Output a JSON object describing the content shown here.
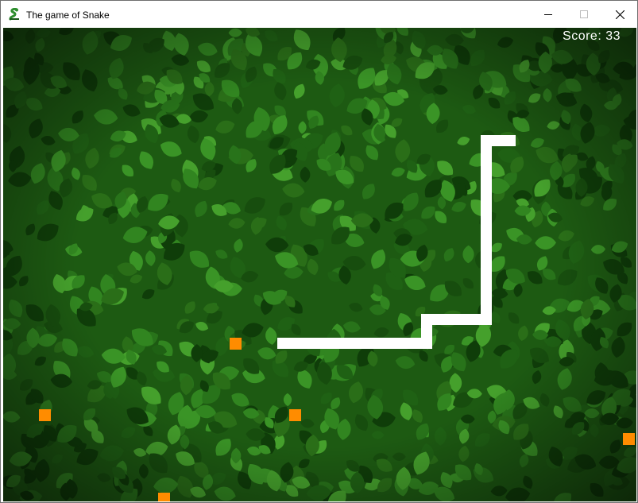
{
  "window": {
    "title": "The game of Snake",
    "app_icon": "snake-icon",
    "controls": [
      "minimize-icon",
      "maximize-icon",
      "close-icon"
    ]
  },
  "game": {
    "score_label": "Score: 33",
    "score": 33,
    "colors": {
      "snake": "#ffffff",
      "food": "#ff8c00",
      "background": "#1e5a14",
      "leaf_light": "#3a8a1e",
      "leaf_dark": "#0e3a08"
    },
    "food_count": 5
  }
}
